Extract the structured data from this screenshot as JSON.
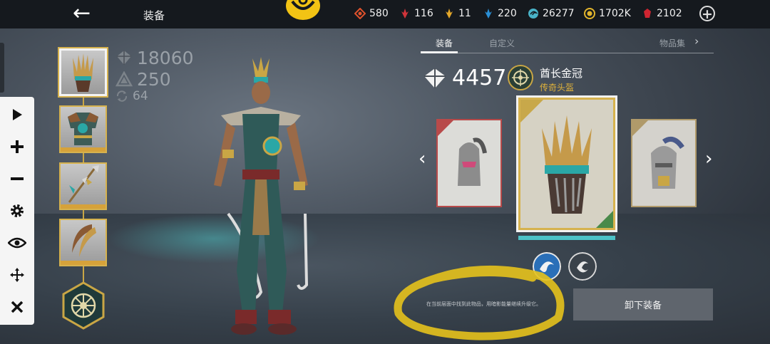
{
  "header": {
    "back_icon": "arrow-left-icon",
    "title": "装备",
    "resources": [
      {
        "icon": "orange-crystal-icon",
        "value": "580",
        "color": "#e0522c"
      },
      {
        "icon": "red-feather-icon",
        "value": "116",
        "color": "#d0343a"
      },
      {
        "icon": "gold-feather-icon",
        "value": "11",
        "color": "#e4a72a"
      },
      {
        "icon": "blue-feather-icon",
        "value": "220",
        "color": "#2a8fd6"
      },
      {
        "icon": "cyan-swirl-icon",
        "value": "26277",
        "color": "#49b3c8"
      },
      {
        "icon": "gold-coin-icon",
        "value": "1702K",
        "color": "#e2b52c"
      },
      {
        "icon": "ruby-gem-icon",
        "value": "2102",
        "color": "#cf2531"
      }
    ],
    "add_icon": "plus-circle-icon"
  },
  "controls": [
    "play-icon",
    "plus-icon",
    "minus-icon",
    "gear-icon",
    "eye-icon",
    "move-icon",
    "close-icon"
  ],
  "gear_slots": [
    "helmet-slot",
    "armor-slot",
    "polearm-slot",
    "blades-slot"
  ],
  "stats": {
    "total_power": "18060",
    "secondary": "250",
    "level": "64"
  },
  "panel": {
    "tabs": [
      "装备",
      "自定义",
      "物品集"
    ],
    "item_power": "4457",
    "item_name": "酋长金冠",
    "item_rarity": "传奇头盔",
    "hint": "在当前层面中找到此物品，用暗影能量继续升级它。",
    "unequip_label": "卸下装备"
  },
  "colors": {
    "accent_gold": "#d6b24e",
    "accent_teal": "#4cc2c7",
    "rarity": "#e0b23a",
    "highlight_marker": "#e6c21c"
  }
}
